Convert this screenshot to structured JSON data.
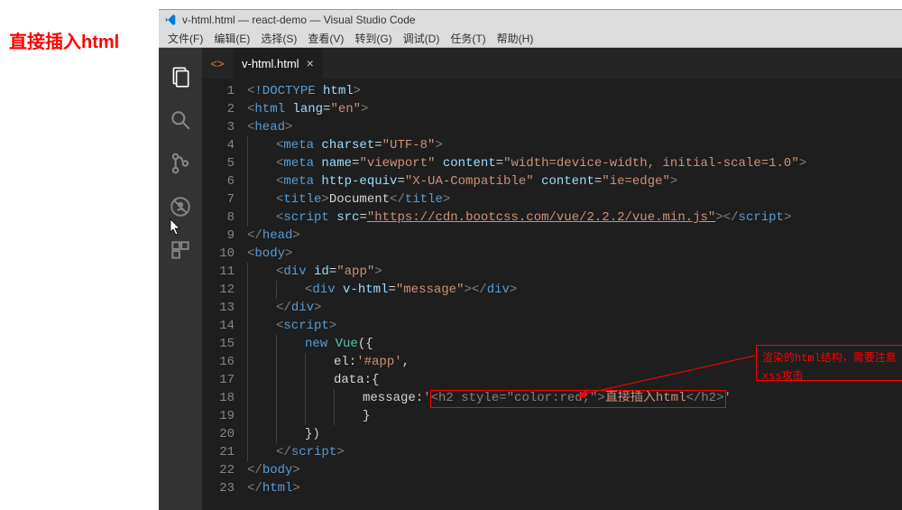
{
  "page_heading": "直接插入html",
  "window": {
    "title": "v-html.html — react-demo — Visual Studio Code"
  },
  "menu": {
    "file": "文件(F)",
    "edit": "编辑(E)",
    "select": "选择(S)",
    "view": "查看(V)",
    "goto": "转到(G)",
    "debug": "调试(D)",
    "tasks": "任务(T)",
    "help": "帮助(H)"
  },
  "tab": {
    "icon": "<>",
    "label": "v-html.html",
    "close": "×"
  },
  "annotation": {
    "text": "渲染的html结构，需要注意xss攻击"
  },
  "code": {
    "lines": 23,
    "l1_doctype": "!DOCTYPE",
    "l1_html": "html",
    "l2_tag": "html",
    "l2_attr": "lang",
    "l2_val": "\"en\"",
    "l3_tag": "head",
    "l4_tag": "meta",
    "l4_attr": "charset",
    "l4_val": "\"UTF-8\"",
    "l5_tag": "meta",
    "l5_attr1": "name",
    "l5_val1": "\"viewport\"",
    "l5_attr2": "content",
    "l5_val2": "\"width=device-width, initial-scale=1.0\"",
    "l6_tag": "meta",
    "l6_attr1": "http-equiv",
    "l6_val1": "\"X-UA-Compatible\"",
    "l6_attr2": "content",
    "l6_val2": "\"ie=edge\"",
    "l7_tag": "title",
    "l7_text": "Document",
    "l8_tag": "script",
    "l8_attr": "src",
    "l8_val": "\"https://cdn.bootcss.com/vue/2.2.2/vue.min.js\"",
    "l9_tag": "head",
    "l10_tag": "body",
    "l11_tag": "div",
    "l11_attr": "id",
    "l11_val": "\"app\"",
    "l12_tag": "div",
    "l12_attr": "v-html",
    "l12_val": "\"message\"",
    "l13_tag": "div",
    "l14_tag": "script",
    "l15_new": "new",
    "l15_vue": "Vue",
    "l16_el": "el:",
    "l16_val": "'#app'",
    "l17_data": "data:{",
    "l18_msg": "message:",
    "l18_q1": "'",
    "l18_embed1": "<h2 style=\"color:red;\">",
    "l18_text": "直接插入html",
    "l18_embed2": "</h2>",
    "l18_q2": "'",
    "l21_tag": "script",
    "l22_tag": "body",
    "l23_tag": "html"
  }
}
